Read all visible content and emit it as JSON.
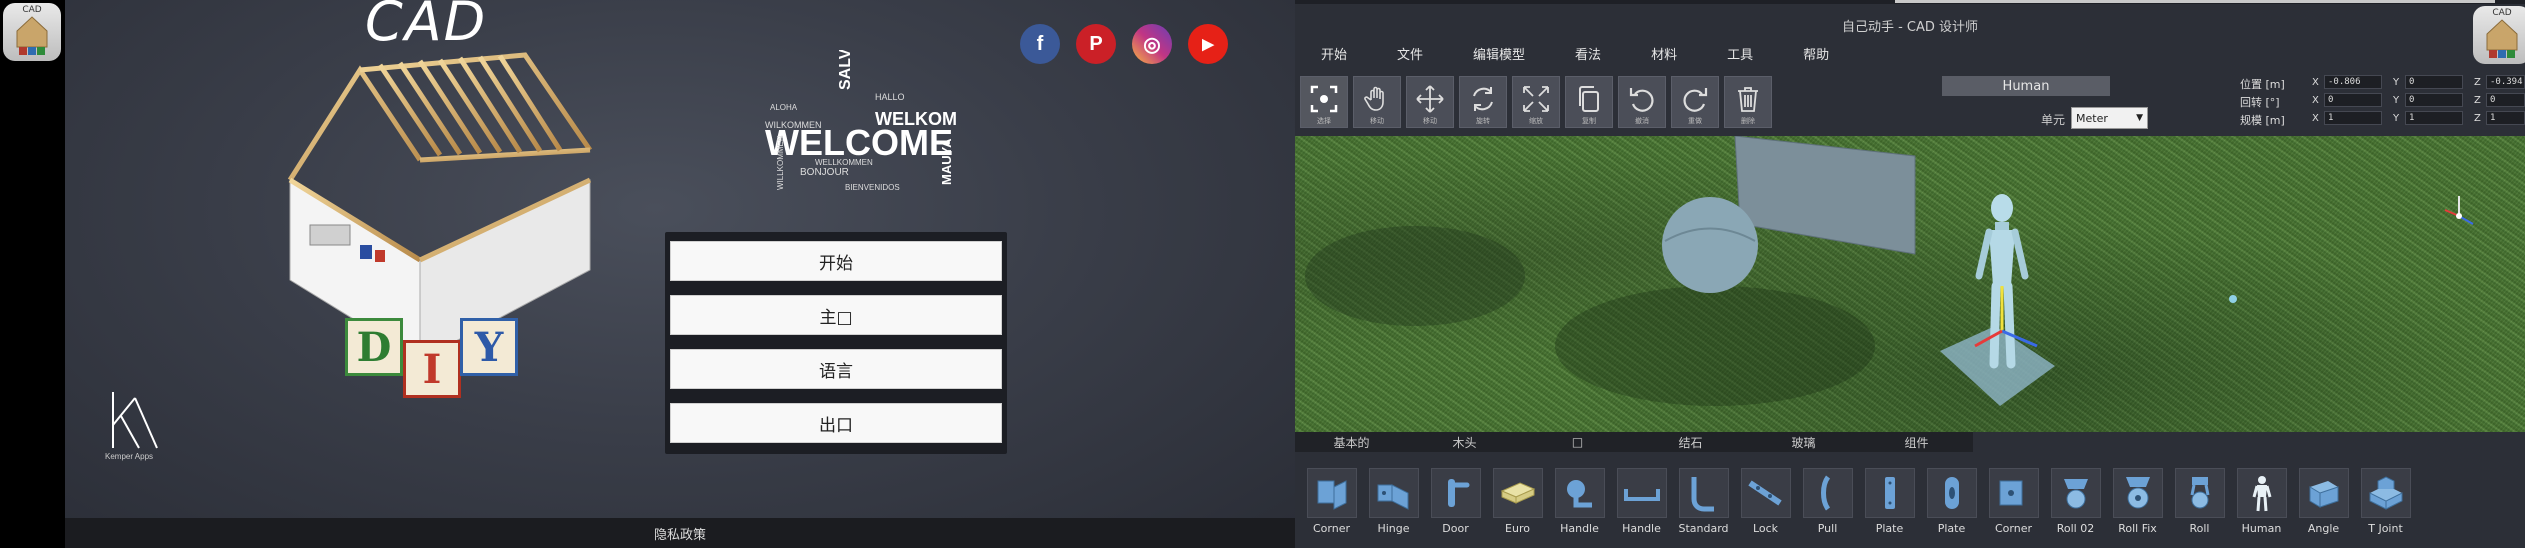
{
  "left": {
    "app_icon": {
      "label": "CAD"
    },
    "title": "CAD",
    "blocks": [
      "D",
      "I",
      "Y"
    ],
    "wordcloud": {
      "main": "WELCOME",
      "words": [
        "WILKOMMEN",
        "SALVE",
        "WELKOM",
        "ALOHA",
        "BONJOUR",
        "HALLO",
        "MAUYA",
        "BIENVENIDOS",
        "WELLKOMMEN",
        "WILLKOMMEN"
      ]
    },
    "social": [
      {
        "name": "facebook",
        "glyph": "f",
        "color": "#3b5998"
      },
      {
        "name": "pinterest",
        "glyph": "P",
        "color": "#cb2027"
      },
      {
        "name": "instagram",
        "glyph": "◎",
        "color": "#c13584"
      },
      {
        "name": "youtube",
        "glyph": "▶",
        "color": "#e62117"
      }
    ],
    "menu": [
      {
        "id": "start",
        "label": "开始"
      },
      {
        "id": "main",
        "label": "主□"
      },
      {
        "id": "language",
        "label": "语言"
      },
      {
        "id": "exit",
        "label": "出口"
      }
    ],
    "logo": {
      "mark": "KA",
      "caption": "Kemper Apps"
    },
    "footer": "隐私政策"
  },
  "right": {
    "window_title": "自己动手 - CAD 设计师",
    "app_icon": {
      "label": "CAD"
    },
    "menubar": [
      "开始",
      "文件",
      "编辑模型",
      "看法",
      "材料",
      "工具",
      "帮助"
    ],
    "toolbar": [
      {
        "icon": "select-icon",
        "label": "选择"
      },
      {
        "icon": "hand-icon",
        "label": "移动"
      },
      {
        "icon": "move-icon",
        "label": "移动"
      },
      {
        "icon": "rotate-icon",
        "label": "旋转"
      },
      {
        "icon": "scale-icon",
        "label": "缩放"
      },
      {
        "icon": "copy-icon",
        "label": "复制"
      },
      {
        "icon": "undo-icon",
        "label": "撤消"
      },
      {
        "icon": "redo-icon",
        "label": "重做"
      },
      {
        "icon": "trash-icon",
        "label": "删除"
      }
    ],
    "selected_object": "Human",
    "unit": {
      "label": "单元",
      "value": "Meter"
    },
    "transform": [
      {
        "label": "位置 [m]",
        "x": "-0.806",
        "y": "0",
        "z": "-0.394"
      },
      {
        "label": "回转 [°]",
        "x": "0",
        "y": "0",
        "z": "0"
      },
      {
        "label": "规模 [m]",
        "x": "1",
        "y": "1",
        "z": "1"
      }
    ],
    "category_tabs": [
      "基本的",
      "木头",
      "□",
      "结石",
      "玻璃",
      "组件"
    ],
    "parts": [
      {
        "label": "Corner",
        "icon": "corner-icon"
      },
      {
        "label": "Hinge",
        "icon": "hinge-icon"
      },
      {
        "label": "Door",
        "icon": "door-handle-icon"
      },
      {
        "label": "Euro",
        "icon": "euro-pallet-icon"
      },
      {
        "label": "Handle",
        "icon": "handle-icon"
      },
      {
        "label": "Handle",
        "icon": "bar-handle-icon"
      },
      {
        "label": "Standard",
        "icon": "standard-bracket-icon"
      },
      {
        "label": "Lock",
        "icon": "lock-icon"
      },
      {
        "label": "Pull",
        "icon": "pull-icon"
      },
      {
        "label": "Plate",
        "icon": "plate-icon"
      },
      {
        "label": "Plate",
        "icon": "round-plate-icon"
      },
      {
        "label": "Corner",
        "icon": "corner-bracket-icon"
      },
      {
        "label": "Roll 02",
        "icon": "roll-icon"
      },
      {
        "label": "Roll Fix",
        "icon": "roll-fix-icon"
      },
      {
        "label": "Roll",
        "icon": "caster-icon"
      },
      {
        "label": "Human",
        "icon": "human-icon"
      },
      {
        "label": "Angle",
        "icon": "angle-icon"
      },
      {
        "label": "T Joint",
        "icon": "t-joint-icon"
      }
    ]
  }
}
